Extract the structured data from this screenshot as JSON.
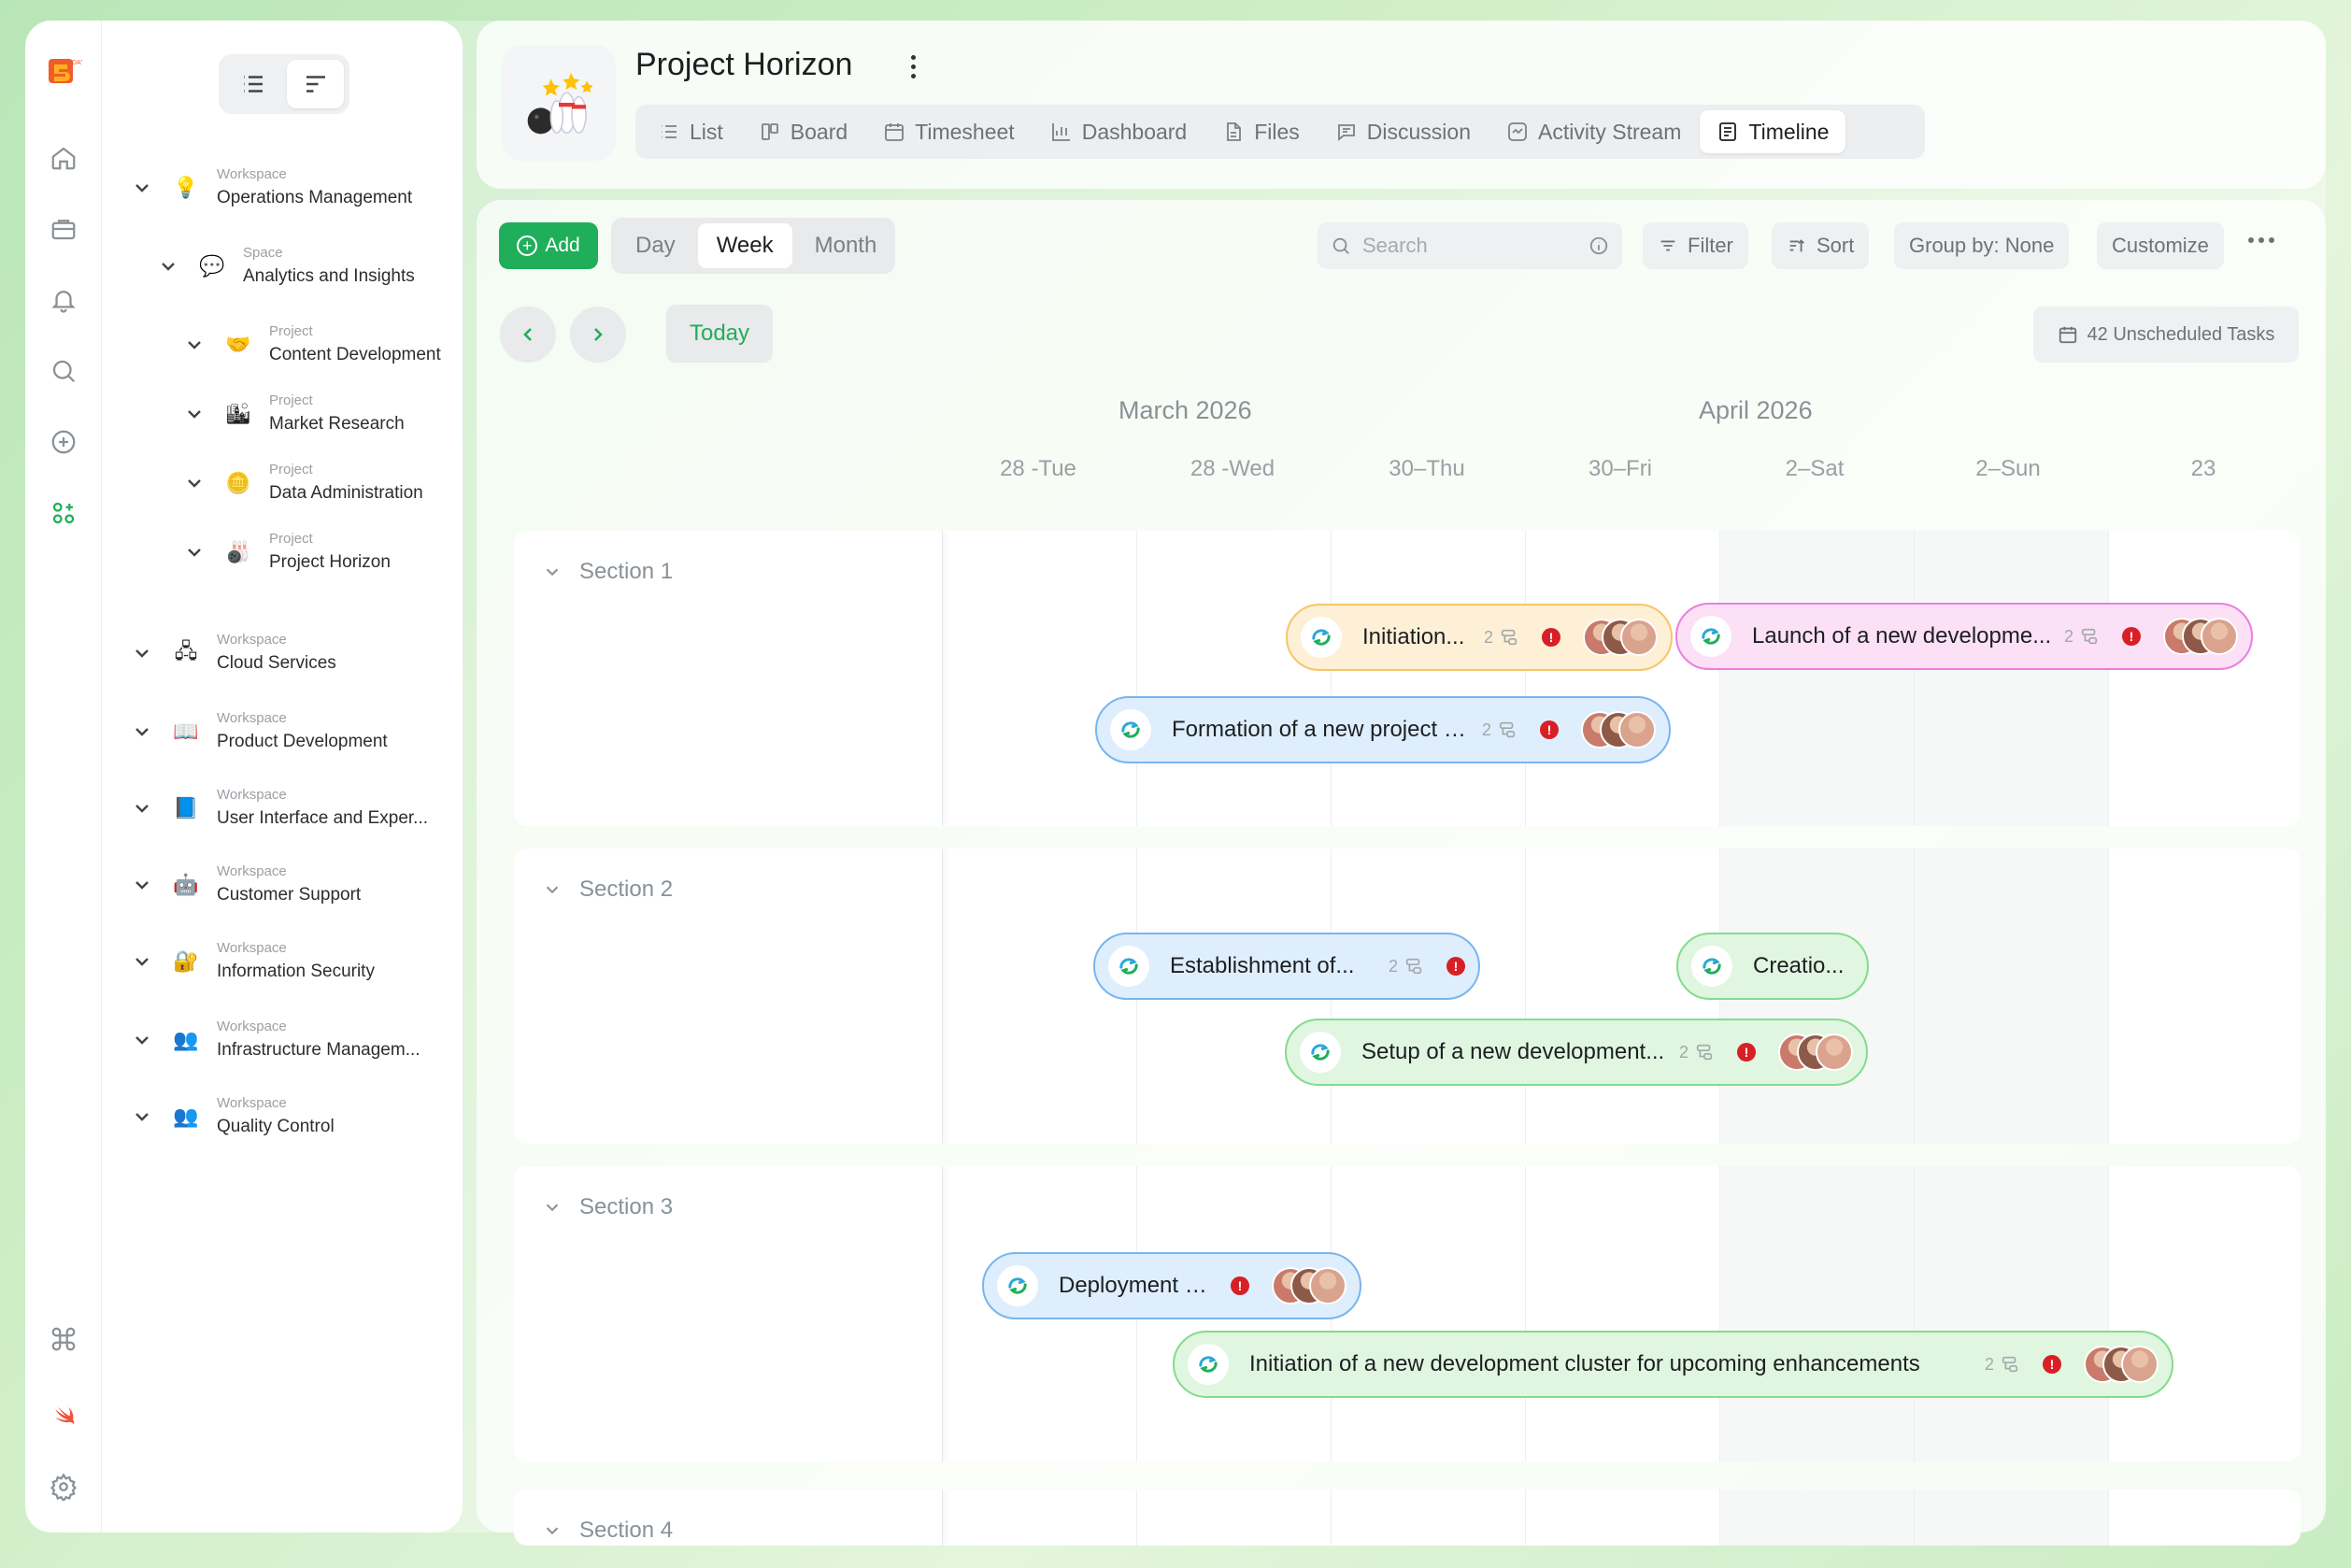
{
  "rail": {
    "icons": [
      "logo-icon",
      "home-icon",
      "briefcase-icon",
      "bell-icon",
      "search-icon",
      "plus-circle-icon",
      "apps-icon",
      "command-icon",
      "swift-icon",
      "settings-icon"
    ]
  },
  "sidebar": {
    "items": [
      {
        "kind": "Workspace",
        "name": "Operations Management",
        "emoji": "💡"
      },
      {
        "kind": "Space",
        "name": "Analytics and Insights",
        "emoji": "💬"
      },
      {
        "kind": "Project",
        "name": "Content Development",
        "emoji": "🤝"
      },
      {
        "kind": "Project",
        "name": "Market Research",
        "emoji": "🏙"
      },
      {
        "kind": "Project",
        "name": "Data Administration",
        "emoji": "🪙"
      },
      {
        "kind": "Project",
        "name": "Project Horizon",
        "emoji": "🎳"
      },
      {
        "kind": "Workspace",
        "name": "Cloud Services",
        "emoji": "🖧"
      },
      {
        "kind": "Workspace",
        "name": "Product Development",
        "emoji": "📖"
      },
      {
        "kind": "Workspace",
        "name": "User Interface and Exper...",
        "emoji": "📘"
      },
      {
        "kind": "Workspace",
        "name": "Customer Support",
        "emoji": "🤖"
      },
      {
        "kind": "Workspace",
        "name": "Information Security",
        "emoji": "🔐"
      },
      {
        "kind": "Workspace",
        "name": "Infrastructure Managem...",
        "emoji": "👥"
      },
      {
        "kind": "Workspace",
        "name": "Quality Control",
        "emoji": "👥"
      }
    ]
  },
  "header": {
    "title": "Project Horizon",
    "tabs": [
      {
        "label": "List",
        "icon": "list-icon"
      },
      {
        "label": "Board",
        "icon": "board-icon"
      },
      {
        "label": "Timesheet",
        "icon": "calendar-icon"
      },
      {
        "label": "Dashboard",
        "icon": "chart-icon"
      },
      {
        "label": "Files",
        "icon": "file-icon"
      },
      {
        "label": "Discussion",
        "icon": "chat-icon"
      },
      {
        "label": "Activity Stream",
        "icon": "activity-icon"
      },
      {
        "label": "Timeline",
        "icon": "timeline-icon"
      }
    ],
    "active_tab": "Timeline"
  },
  "toolbar": {
    "add_label": "Add",
    "ranges": [
      "Day",
      "Week",
      "Month"
    ],
    "active_range": "Week",
    "search_placeholder": "Search",
    "filter_label": "Filter",
    "sort_label": "Sort",
    "group_label": "Group by: None",
    "customize_label": "Customize",
    "today_label": "Today",
    "unscheduled_label": "42 Unscheduled Tasks"
  },
  "timeline": {
    "months": [
      "March 2026",
      "April 2026"
    ],
    "days": [
      "28 -Tue",
      "28 -Wed",
      "30–Thu",
      "30–Fri",
      "2–Sat",
      "2–Sun",
      "23"
    ],
    "sections": [
      {
        "title": "Section 1"
      },
      {
        "title": "Section 2"
      },
      {
        "title": "Section 3"
      },
      {
        "title": "Section 4"
      }
    ],
    "tasks": [
      {
        "label": "Initiation...",
        "count": "2",
        "color": "orange",
        "alert": true,
        "avatars": true
      },
      {
        "label": "Launch of a new developme...",
        "count": "2",
        "color": "pink",
        "alert": true,
        "avatars": true
      },
      {
        "label": "Formation of a new project c...",
        "count": "2",
        "color": "blue",
        "alert": true,
        "avatars": true
      },
      {
        "label": "Establishment of...",
        "count": "2",
        "color": "blue",
        "alert": true,
        "avatars": false
      },
      {
        "label": "Creatio...",
        "count": "",
        "color": "green",
        "alert": false,
        "avatars": false
      },
      {
        "label": "Setup of a new development...",
        "count": "2",
        "color": "green",
        "alert": true,
        "avatars": true
      },
      {
        "label": "Deployment o...",
        "count": "",
        "color": "blue",
        "alert": true,
        "avatars": true
      },
      {
        "label": "Initiation of a new development cluster for upcoming enhancements",
        "count": "2",
        "color": "green",
        "alert": true,
        "avatars": true
      }
    ]
  }
}
